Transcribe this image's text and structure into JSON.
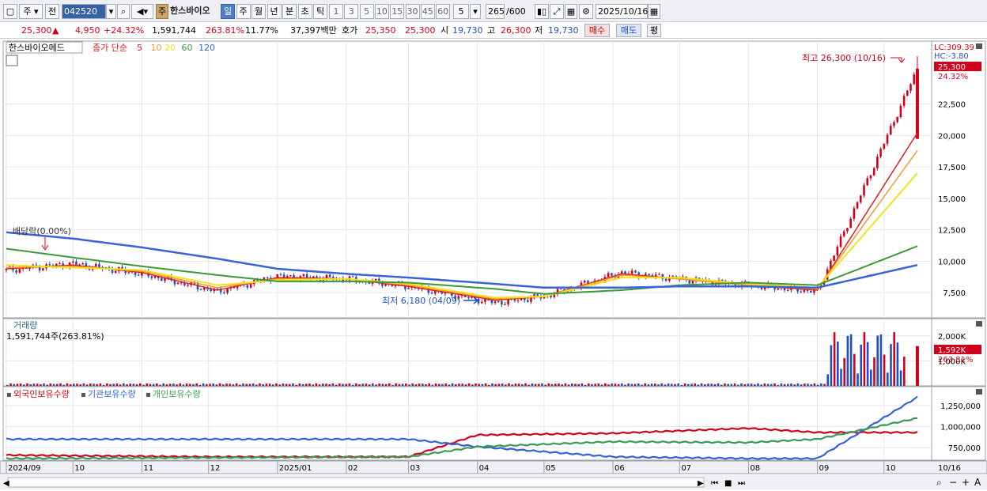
{
  "toolbar": {
    "market_type": "주",
    "prev_label": "전",
    "code": "042520",
    "stock_name": "한스바이오",
    "period_tabs": [
      "일",
      "주",
      "월",
      "년",
      "분",
      "초",
      "틱"
    ],
    "active_period": "일",
    "interval_buttons": [
      "1",
      "3",
      "5",
      "10",
      "15",
      "30",
      "45",
      "60"
    ],
    "interval_select": "5",
    "count": "265",
    "count_total": "/600",
    "date": "2025/10/16",
    "main_type_badge": "주"
  },
  "quote": {
    "price": "25,300",
    "change_arrow": "▲",
    "change": "4,950",
    "change_pct": "+24.32%",
    "volume": "1,591,744",
    "volume_ratio": "263.81%",
    "turnover": "11.77%",
    "trade_value": "37,397백만",
    "hoga_label": "호가",
    "hoga_ask": "25,350",
    "hoga_bid": "25,300",
    "open_label": "시",
    "open": "19,730",
    "high_label": "고",
    "high": "26,300",
    "low_label": "저",
    "low": "19,730",
    "buy_label": "매수",
    "sell_label": "매도",
    "eval_label": "평"
  },
  "price_panel": {
    "title": "한스바이오메드",
    "ma_label": "종가 단순",
    "ma_periods": [
      "5",
      "10",
      "20",
      "60",
      "120"
    ],
    "lc_label": "LC:309.39",
    "hc_label": "HC:-3.80",
    "last_price_tag": "25,300",
    "last_pct_tag": "24.32%",
    "max_annotation": "최고 26,300 (10/16)",
    "min_annotation": "최저 6,180 (04/09)",
    "dividend_annotation": "배당락(0.00%)",
    "y_ticks": [
      "22,500",
      "20,000",
      "17,500",
      "15,000",
      "12,500",
      "10,000",
      "7,500"
    ]
  },
  "volume_panel": {
    "title": "거래량",
    "value_label": "1,591,744주(263.81%)",
    "y_ticks": [
      "2,000K",
      "1,000K"
    ],
    "last_tag": "1,592K",
    "last_pct_tag": "263.81%"
  },
  "holding_panel": {
    "legend": [
      "외국인보유수량",
      "기관보유수량",
      "개인보유수량"
    ],
    "y_ticks": [
      "1,250,000",
      "1,000,000",
      "750,000"
    ]
  },
  "x_axis": {
    "labels": [
      "2024/09",
      "10",
      "11",
      "12",
      "2025/01",
      "02",
      "03",
      "04",
      "05",
      "06",
      "07",
      "08",
      "09",
      "10"
    ],
    "right_label": "10/16"
  },
  "colors": {
    "up": "#d0021b",
    "down": "#1f4fc8",
    "ma5": "#e0201c",
    "ma10": "#f39a2b",
    "ma20": "#f2e21b",
    "ma60": "#3a9a3a",
    "ma120": "#3b62d6",
    "foreign": "#d0021b",
    "inst": "#2f63d6",
    "retail": "#3a9a55"
  },
  "chart_data": [
    {
      "type": "candlestick",
      "title": "한스바이오메드",
      "x": [
        "2024-09",
        "2024-10",
        "2024-11",
        "2024-12",
        "2025-01",
        "2025-02",
        "2025-03",
        "2025-04",
        "2025-05",
        "2025-06",
        "2025-07",
        "2025-08",
        "2025-09",
        "2025-10-16"
      ],
      "close": [
        9300,
        9800,
        9000,
        7600,
        8800,
        8600,
        8000,
        6700,
        7200,
        9100,
        8600,
        8100,
        7600,
        25300
      ],
      "series": [
        {
          "name": "5",
          "values": [
            9400,
            9700,
            9100,
            7700,
            8700,
            8600,
            8000,
            6900,
            7200,
            9000,
            8600,
            8100,
            7700,
            20200
          ]
        },
        {
          "name": "10",
          "values": [
            9500,
            9600,
            9200,
            7900,
            8600,
            8600,
            8100,
            7000,
            7200,
            8900,
            8600,
            8100,
            7800,
            18800
          ]
        },
        {
          "name": "20",
          "values": [
            9700,
            9500,
            9300,
            8100,
            8500,
            8600,
            8200,
            7100,
            7200,
            8700,
            8700,
            8200,
            7900,
            17000
          ]
        },
        {
          "name": "60",
          "values": [
            11000,
            10300,
            9600,
            8900,
            8400,
            8400,
            8300,
            7800,
            7400,
            7700,
            8100,
            8300,
            8100,
            11200
          ]
        },
        {
          "name": "120",
          "values": [
            12300,
            11800,
            11100,
            10200,
            9400,
            9000,
            8700,
            8200,
            7900,
            7900,
            8000,
            8000,
            7900,
            9700
          ]
        }
      ],
      "ylim": [
        5500,
        27500
      ]
    },
    {
      "type": "bar",
      "title": "거래량",
      "categories": [
        "2025-09",
        "2025-10-16"
      ],
      "values": [
        1591744
      ],
      "ylim": [
        0,
        2500000
      ]
    },
    {
      "type": "line",
      "x": [
        "2024-09",
        "2024-12",
        "2025-03",
        "2025-04",
        "2025-06",
        "2025-08",
        "2025-09",
        "2025-10-16"
      ],
      "series": [
        {
          "name": "외국인보유수량",
          "values": [
            660000,
            640000,
            640000,
            900000,
            920000,
            980000,
            930000,
            930000
          ]
        },
        {
          "name": "기관보유수량",
          "values": [
            850000,
            850000,
            850000,
            760000,
            640000,
            620000,
            620000,
            1350000
          ]
        },
        {
          "name": "개인보유수량",
          "values": [
            620000,
            630000,
            640000,
            760000,
            820000,
            810000,
            850000,
            1100000
          ]
        }
      ],
      "ylim": [
        600000,
        1400000
      ]
    }
  ]
}
